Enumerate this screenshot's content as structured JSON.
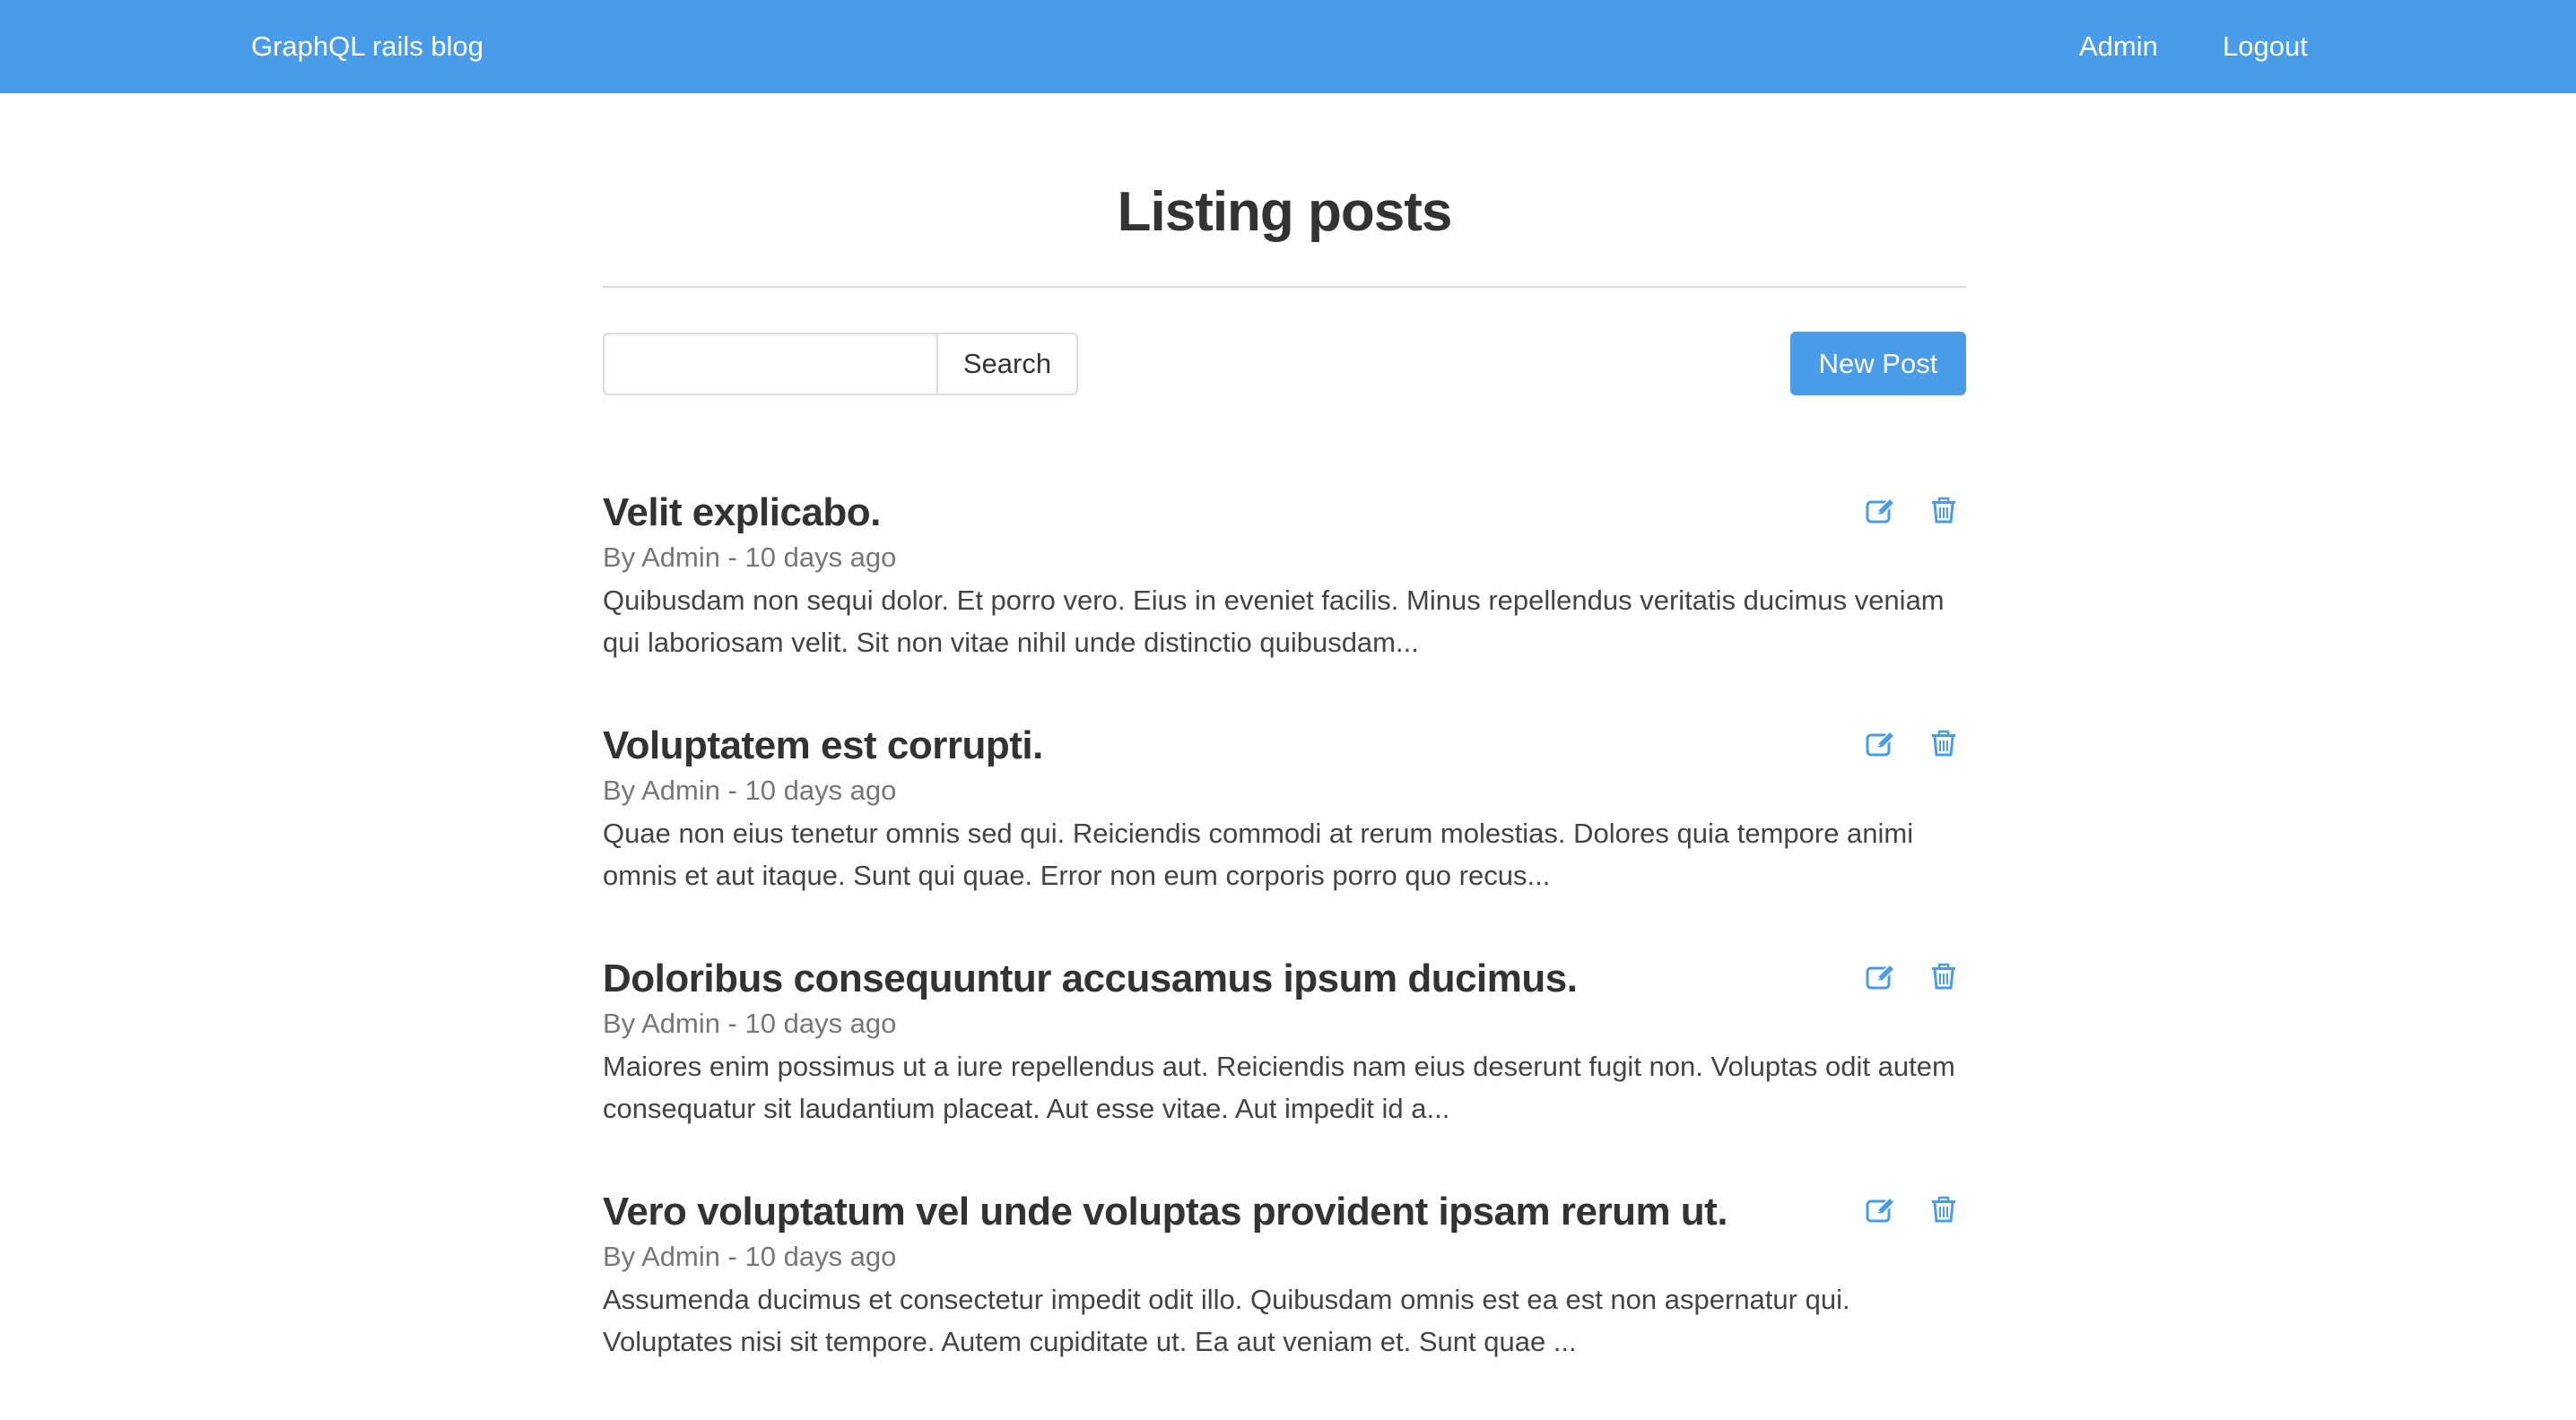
{
  "navbar": {
    "brand": "GraphQL rails blog",
    "links": [
      {
        "label": "Admin"
      },
      {
        "label": "Logout"
      }
    ],
    "background_color": "#4a9be8"
  },
  "page": {
    "title": "Listing posts"
  },
  "search": {
    "value": "",
    "placeholder": "",
    "button_label": "Search"
  },
  "new_post_button": {
    "label": "New Post"
  },
  "icons": {
    "edit": "edit-icon",
    "delete": "trash-icon"
  },
  "accent_color": "#4a9be8",
  "posts": [
    {
      "title": "Velit explicabo.",
      "meta": "By Admin - 10 days ago",
      "excerpt": "Quibusdam non sequi dolor. Et porro vero. Eius in eveniet facilis. Minus repellendus veritatis ducimus veniam qui laboriosam velit. Sit non vitae nihil unde distinctio quibusdam..."
    },
    {
      "title": "Voluptatem est corrupti.",
      "meta": "By Admin - 10 days ago",
      "excerpt": "Quae non eius tenetur omnis sed qui. Reiciendis commodi at rerum molestias. Dolores quia tempore animi omnis et aut itaque. Sunt qui quae. Error non eum corporis porro quo recus..."
    },
    {
      "title": "Doloribus consequuntur accusamus ipsum ducimus.",
      "meta": "By Admin - 10 days ago",
      "excerpt": "Maiores enim possimus ut a iure repellendus aut. Reiciendis nam eius deserunt fugit non. Voluptas odit autem consequatur sit laudantium placeat. Aut esse vitae. Aut impedit id a..."
    },
    {
      "title": "Vero voluptatum vel unde voluptas provident ipsam rerum ut.",
      "meta": "By Admin - 10 days ago",
      "excerpt": "Assumenda ducimus et consectetur impedit odit illo. Quibusdam omnis est ea est non aspernatur qui. Voluptates nisi sit tempore. Autem cupiditate ut. Ea aut veniam et. Sunt quae ..."
    }
  ]
}
